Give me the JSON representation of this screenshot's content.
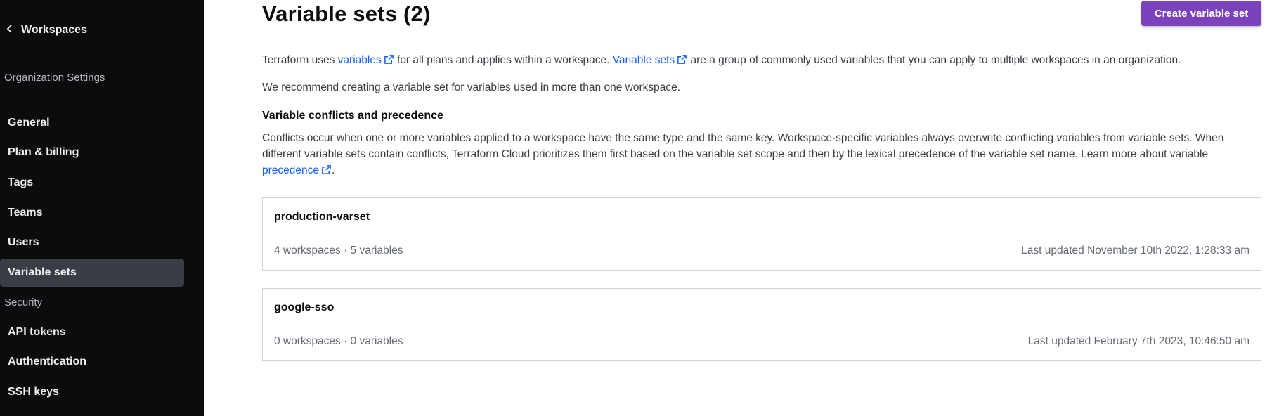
{
  "sidebar": {
    "back_label": "Workspaces",
    "org_heading": "Organization Settings",
    "items": [
      {
        "label": "General"
      },
      {
        "label": "Plan & billing"
      },
      {
        "label": "Tags"
      },
      {
        "label": "Teams"
      },
      {
        "label": "Users"
      },
      {
        "label": "Variable sets",
        "active": true
      }
    ],
    "security_heading": "Security",
    "security_items": [
      {
        "label": "API tokens"
      },
      {
        "label": "Authentication"
      },
      {
        "label": "SSH keys"
      }
    ]
  },
  "header": {
    "title": "Variable sets (2)",
    "create_label": "Create variable set"
  },
  "intro": {
    "p1_a": "Terraform uses ",
    "p1_link1": "variables",
    "p1_b": " for all plans and applies within a workspace. ",
    "p1_link2": "Variable sets",
    "p1_c": " are a group of commonly used variables that you can apply to multiple workspaces in an organization.",
    "p2": "We recommend creating a variable set for variables used in more than one workspace."
  },
  "conflicts": {
    "heading": "Variable conflicts and precedence",
    "text": "Conflicts occur when one or more variables applied to a workspace have the same type and the same key. Workspace-specific variables always overwrite conflicting variables from variable sets. When different variable sets contain conflicts, Terraform Cloud prioritizes them first based on the variable set scope and then by the lexical precedence of the variable set name. Learn more about variable ",
    "link": "precedence",
    "end": "."
  },
  "varsets": [
    {
      "name": "production-varset",
      "meta": "4 workspaces · 5 variables",
      "updated": "Last updated November 10th 2022, 1:28:33 am"
    },
    {
      "name": "google-sso",
      "meta": "0 workspaces · 0 variables",
      "updated": "Last updated February 7th 2023, 10:46:50 am"
    }
  ],
  "colors": {
    "sidebar_bg": "#0c0c0e",
    "active_bg": "#3b3d45",
    "brand_button": "#7b42bc",
    "link": "#1060ff"
  },
  "icons": {
    "back": "chevron-left-icon",
    "external": "external-link-icon"
  }
}
